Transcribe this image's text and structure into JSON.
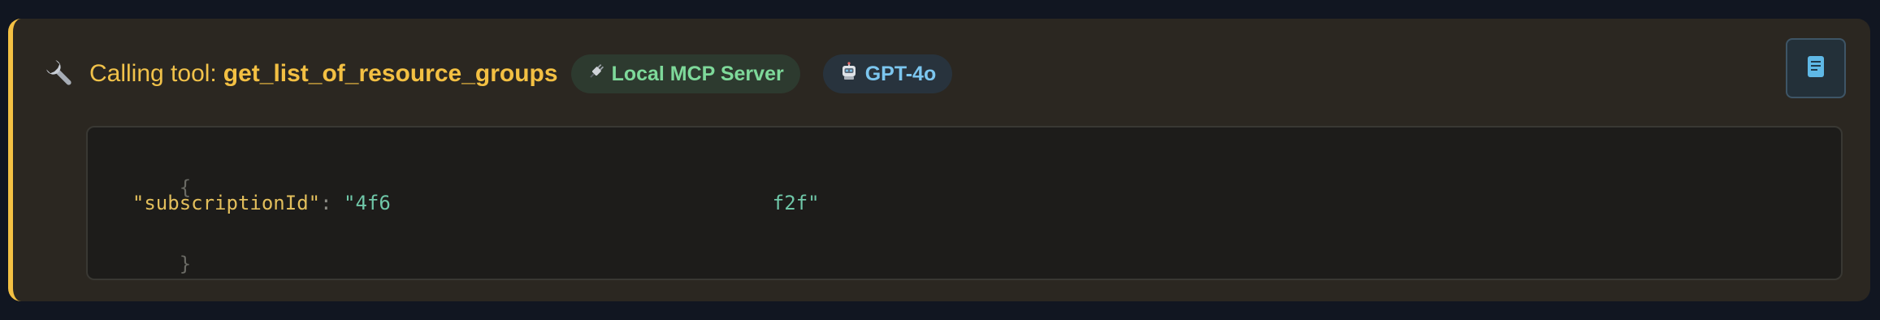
{
  "tool_call": {
    "calling_label": "Calling tool:",
    "tool_name": "get_list_of_resource_groups",
    "server_badge": {
      "label": "Local MCP Server",
      "icon": "plug-icon"
    },
    "model_badge": {
      "label": "GPT-4o",
      "icon": "robot-icon"
    },
    "copy_button": {
      "icon": "clipboard-icon"
    }
  },
  "arguments": {
    "open_brace": "{",
    "key": "\"subscriptionId\"",
    "colon": ": ",
    "value_start": "\"4f6",
    "value_end": "f2f\"",
    "close_brace": "}"
  },
  "colors": {
    "accent": "#f3c043",
    "server_badge_text": "#7ed99a",
    "model_badge_text": "#7cc6ef"
  }
}
